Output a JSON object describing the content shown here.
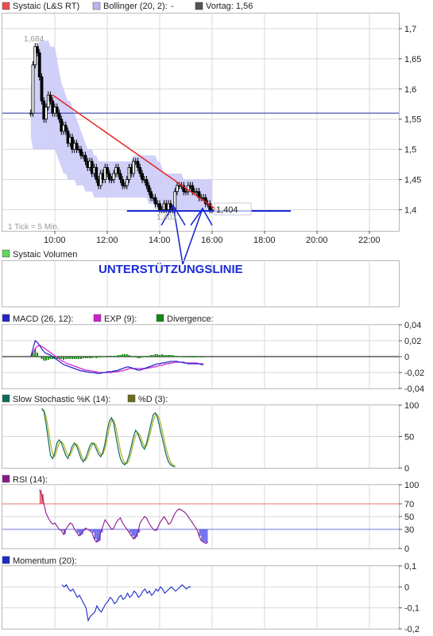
{
  "colors": {
    "price": "#000000",
    "bollinger_fill": "#c8c8f8",
    "vortag": "#1d2a9e",
    "trendline": "#e8231c",
    "support": "#1a2bd6",
    "macd": "#2424c8",
    "exp": "#cc22cc",
    "divergence": "#118811",
    "stoch_k": "#0b6b5a",
    "stoch_d": "#b0b020",
    "rsi": "#8a1a8a",
    "rsi_fill": "#5050e8",
    "rsi_over": "#e85050",
    "momentum": "#1d2ac8"
  },
  "chart_data": [
    {
      "type": "line",
      "legend": [
        {
          "label": "Systaic (L&S RT)",
          "icon": "legend-square-red"
        },
        {
          "label": "Bollinger (20, 2):",
          "value": "-",
          "icon": "legend-square-lavender"
        },
        {
          "label": "Vortag: 1,56",
          "icon": "legend-square-gray"
        }
      ],
      "x_ticks": [
        "10:00",
        "12:00",
        "14:00",
        "16:00",
        "18:00",
        "20:00",
        "22:00"
      ],
      "y_ticks": [
        "1,7",
        "1,65",
        "1,6",
        "1,55",
        "1,5",
        "1,45",
        "1,4"
      ],
      "ylim": [
        1.365,
        1.725
      ],
      "note": "1 Tick = 5 Min.",
      "max_label": "1,684",
      "min_label": "1,403",
      "last_label": "1,404",
      "annotation": "UNTERSTÜTZUNGSLINIE",
      "vortag": 1.56,
      "times": [
        "09:05",
        "09:10",
        "09:15",
        "09:20",
        "09:25",
        "09:30",
        "09:35",
        "09:40",
        "09:45",
        "09:50",
        "09:55",
        "10:00",
        "10:05",
        "10:10",
        "10:15",
        "10:20",
        "10:25",
        "10:30",
        "10:35",
        "10:40",
        "10:45",
        "10:50",
        "10:55",
        "11:00",
        "11:05",
        "11:10",
        "11:15",
        "11:20",
        "11:25",
        "11:30",
        "11:35",
        "11:40",
        "11:45",
        "11:50",
        "11:55",
        "12:00",
        "12:05",
        "12:10",
        "12:15",
        "12:20",
        "12:25",
        "12:30",
        "12:35",
        "12:40",
        "12:45",
        "12:50",
        "12:55",
        "13:00",
        "13:05",
        "13:10",
        "13:15",
        "13:20",
        "13:25",
        "13:30",
        "13:35",
        "13:40",
        "13:45",
        "13:50",
        "13:55",
        "14:00",
        "14:05",
        "14:10",
        "14:15",
        "14:20",
        "14:25",
        "14:30",
        "14:35",
        "14:40",
        "14:45",
        "14:50",
        "14:55",
        "15:00",
        "15:05",
        "15:10",
        "15:15",
        "15:20",
        "15:25",
        "15:30",
        "15:35",
        "15:40",
        "15:45",
        "15:50",
        "15:55",
        "16:00"
      ],
      "close": [
        1.56,
        1.64,
        1.67,
        1.66,
        1.62,
        1.58,
        1.55,
        1.57,
        1.59,
        1.58,
        1.56,
        1.57,
        1.56,
        1.55,
        1.53,
        1.54,
        1.53,
        1.51,
        1.52,
        1.5,
        1.51,
        1.5,
        1.5,
        1.49,
        1.49,
        1.48,
        1.47,
        1.48,
        1.46,
        1.47,
        1.45,
        1.44,
        1.46,
        1.45,
        1.47,
        1.46,
        1.45,
        1.45,
        1.46,
        1.47,
        1.46,
        1.45,
        1.44,
        1.44,
        1.45,
        1.47,
        1.46,
        1.48,
        1.48,
        1.47,
        1.46,
        1.45,
        1.45,
        1.44,
        1.43,
        1.42,
        1.42,
        1.41,
        1.41,
        1.4,
        1.4,
        1.41,
        1.4,
        1.41,
        1.4,
        1.4,
        1.43,
        1.44,
        1.44,
        1.44,
        1.43,
        1.43,
        1.44,
        1.44,
        1.43,
        1.43,
        1.43,
        1.42,
        1.42,
        1.42,
        1.41,
        1.41,
        1.4,
        1.4
      ],
      "bollinger_upper": [
        1.6,
        1.64,
        1.66,
        1.67,
        1.68,
        1.68,
        1.68,
        1.68,
        1.68,
        1.67,
        1.67,
        1.67,
        1.65,
        1.63,
        1.61,
        1.6,
        1.59,
        1.58,
        1.58,
        1.57,
        1.56,
        1.55,
        1.54,
        1.53,
        1.52,
        1.51,
        1.5,
        1.5,
        1.5,
        1.49,
        1.49,
        1.48,
        1.48,
        1.48,
        1.48,
        1.48,
        1.48,
        1.48,
        1.48,
        1.48,
        1.48,
        1.48,
        1.48,
        1.48,
        1.48,
        1.48,
        1.48,
        1.49,
        1.49,
        1.49,
        1.49,
        1.49,
        1.49,
        1.49,
        1.49,
        1.49,
        1.49,
        1.49,
        1.48,
        1.48,
        1.47,
        1.46,
        1.46,
        1.46,
        1.46,
        1.46,
        1.46,
        1.46,
        1.46,
        1.46,
        1.45,
        1.45,
        1.45,
        1.45,
        1.45,
        1.45,
        1.45,
        1.45,
        1.45,
        1.45,
        1.45,
        1.45,
        1.45,
        1.45
      ],
      "bollinger_lower": [
        1.52,
        1.5,
        1.5,
        1.5,
        1.5,
        1.5,
        1.5,
        1.5,
        1.5,
        1.5,
        1.5,
        1.5,
        1.49,
        1.48,
        1.47,
        1.46,
        1.46,
        1.45,
        1.45,
        1.45,
        1.45,
        1.44,
        1.44,
        1.44,
        1.44,
        1.43,
        1.43,
        1.43,
        1.43,
        1.42,
        1.42,
        1.42,
        1.42,
        1.42,
        1.42,
        1.42,
        1.42,
        1.42,
        1.42,
        1.42,
        1.42,
        1.42,
        1.42,
        1.42,
        1.42,
        1.42,
        1.42,
        1.42,
        1.42,
        1.42,
        1.42,
        1.42,
        1.42,
        1.42,
        1.41,
        1.41,
        1.41,
        1.4,
        1.4,
        1.4,
        1.4,
        1.4,
        1.4,
        1.4,
        1.4,
        1.4,
        1.4,
        1.4,
        1.4,
        1.4,
        1.4,
        1.4,
        1.4,
        1.4,
        1.4,
        1.4,
        1.4,
        1.4,
        1.4,
        1.4,
        1.4,
        1.4,
        1.4,
        1.4
      ]
    },
    {
      "type": "bar",
      "legend": [
        {
          "label": "Systaic Volumen",
          "icon": "legend-square-green"
        }
      ],
      "values": []
    },
    {
      "type": "line",
      "legend": [
        {
          "label": "MACD (26, 12):",
          "icon": "legend-square-blue"
        },
        {
          "label": "EXP (9):",
          "icon": "legend-square-magenta"
        },
        {
          "label": "Divergence:",
          "icon": "legend-square-darkgreen"
        }
      ],
      "y_ticks": [
        "0,04",
        "0,02",
        "0",
        "-0,02",
        "-0,04"
      ],
      "ylim": [
        -0.04,
        0.04
      ],
      "macd": [
        0.0,
        0.01,
        0.02,
        0.018,
        0.014,
        0.01,
        0.006,
        0.004,
        0.003,
        0.002,
        0.0,
        -0.002,
        -0.004,
        -0.006,
        -0.008,
        -0.01,
        -0.011,
        -0.012,
        -0.013,
        -0.014,
        -0.015,
        -0.016,
        -0.017,
        -0.018,
        -0.018,
        -0.019,
        -0.019,
        -0.02,
        -0.02,
        -0.02,
        -0.021,
        -0.021,
        -0.021,
        -0.02,
        -0.02,
        -0.019,
        -0.019,
        -0.019,
        -0.018,
        -0.018,
        -0.017,
        -0.016,
        -0.015,
        -0.014,
        -0.013,
        -0.013,
        -0.014,
        -0.015,
        -0.016,
        -0.017,
        -0.017,
        -0.016,
        -0.015,
        -0.014,
        -0.013,
        -0.012,
        -0.011,
        -0.01,
        -0.009,
        -0.009,
        -0.008,
        -0.008,
        -0.007,
        -0.007,
        -0.006,
        -0.006,
        -0.006,
        -0.006,
        -0.007,
        -0.007,
        -0.008,
        -0.008,
        -0.009,
        -0.009,
        -0.009,
        -0.009,
        -0.009,
        -0.009,
        -0.01,
        -0.01
      ],
      "exp": [
        0.0,
        0.005,
        0.01,
        0.013,
        0.014,
        0.013,
        0.011,
        0.009,
        0.007,
        0.005,
        0.003,
        0.001,
        -0.001,
        -0.003,
        -0.005,
        -0.006,
        -0.008,
        -0.009,
        -0.01,
        -0.011,
        -0.012,
        -0.013,
        -0.014,
        -0.015,
        -0.016,
        -0.017,
        -0.017,
        -0.018,
        -0.018,
        -0.019,
        -0.019,
        -0.02,
        -0.02,
        -0.02,
        -0.02,
        -0.02,
        -0.02,
        -0.02,
        -0.019,
        -0.019,
        -0.019,
        -0.018,
        -0.018,
        -0.017,
        -0.016,
        -0.015,
        -0.015,
        -0.015,
        -0.015,
        -0.015,
        -0.015,
        -0.015,
        -0.015,
        -0.015,
        -0.014,
        -0.014,
        -0.013,
        -0.013,
        -0.012,
        -0.011,
        -0.011,
        -0.01,
        -0.009,
        -0.009,
        -0.008,
        -0.008,
        -0.007,
        -0.007,
        -0.007,
        -0.007,
        -0.007,
        -0.008,
        -0.008,
        -0.008,
        -0.008,
        -0.008,
        -0.008,
        -0.009,
        -0.009,
        -0.009
      ],
      "divergence": [
        0.0,
        0.005,
        0.01,
        0.005,
        0.0,
        -0.003,
        -0.005,
        -0.005,
        -0.004,
        -0.003,
        -0.003,
        -0.003,
        -0.003,
        -0.003,
        -0.003,
        -0.004,
        -0.003,
        -0.003,
        -0.003,
        -0.003,
        -0.003,
        -0.003,
        -0.003,
        -0.003,
        -0.002,
        -0.002,
        -0.002,
        -0.002,
        -0.002,
        -0.001,
        -0.002,
        -0.001,
        -0.001,
        0.0,
        0.0,
        0.001,
        0.001,
        0.001,
        0.001,
        0.001,
        0.002,
        0.002,
        0.003,
        0.003,
        0.003,
        0.002,
        0.001,
        0.0,
        -0.001,
        -0.002,
        -0.002,
        -0.001,
        0.0,
        0.001,
        0.001,
        0.002,
        0.002,
        0.003,
        0.003,
        0.002,
        0.003,
        0.002,
        0.002,
        0.002,
        0.002,
        0.002,
        0.001,
        0.001,
        0.0,
        0.0,
        -0.001,
        0.0,
        -0.001,
        -0.001,
        -0.001,
        -0.001,
        -0.001,
        0.0,
        -0.001,
        -0.001
      ]
    },
    {
      "type": "line",
      "legend": [
        {
          "label": "Slow Stochastic %K (14):",
          "icon": "legend-square-teal"
        },
        {
          "label": "%D (3):",
          "icon": "legend-square-olive"
        }
      ],
      "y_ticks": [
        "100",
        "50",
        "0"
      ],
      "ylim": [
        0,
        100
      ],
      "k": [
        95,
        90,
        70,
        45,
        20,
        15,
        25,
        40,
        45,
        40,
        30,
        20,
        15,
        25,
        35,
        40,
        35,
        25,
        15,
        10,
        15,
        25,
        35,
        40,
        38,
        30,
        22,
        18,
        25,
        40,
        60,
        75,
        80,
        70,
        50,
        30,
        15,
        8,
        5,
        10,
        20,
        35,
        50,
        60,
        55,
        45,
        35,
        30,
        40,
        55,
        70,
        85,
        88,
        80,
        65,
        50,
        35,
        20,
        10,
        5,
        3,
        2
      ],
      "d": [
        92,
        92,
        82,
        62,
        40,
        22,
        18,
        30,
        40,
        42,
        38,
        28,
        20,
        20,
        28,
        36,
        38,
        32,
        22,
        14,
        12,
        18,
        28,
        36,
        40,
        36,
        28,
        22,
        22,
        32,
        48,
        65,
        76,
        76,
        64,
        46,
        28,
        15,
        8,
        7,
        12,
        25,
        40,
        52,
        56,
        52,
        42,
        34,
        35,
        46,
        60,
        75,
        84,
        85,
        76,
        62,
        46,
        30,
        18,
        9,
        5,
        3
      ]
    },
    {
      "type": "line",
      "legend": [
        {
          "label": "RSI (14):",
          "icon": "legend-square-purple"
        }
      ],
      "y_ticks": [
        "100",
        "70",
        "50",
        "30",
        "0"
      ],
      "ylim": [
        0,
        100
      ],
      "levels": [
        70,
        30
      ],
      "rsi": [
        92,
        85,
        70,
        55,
        48,
        42,
        38,
        40,
        35,
        30,
        28,
        22,
        30,
        35,
        40,
        38,
        30,
        25,
        20,
        22,
        28,
        32,
        30,
        28,
        25,
        15,
        10,
        12,
        25,
        35,
        45,
        40,
        35,
        30,
        32,
        40,
        45,
        48,
        40,
        35,
        30,
        25,
        20,
        15,
        18,
        25,
        40,
        45,
        50,
        48,
        40,
        35,
        30,
        28,
        32,
        40,
        45,
        50,
        45,
        38,
        40,
        48,
        55,
        60,
        62,
        60,
        58,
        55,
        50,
        45,
        40,
        35,
        30,
        20,
        12,
        10,
        8,
        10
      ]
    },
    {
      "type": "line",
      "legend": [
        {
          "label": "Momentum (20):",
          "icon": "legend-square-navy"
        }
      ],
      "y_ticks": [
        "0,1",
        "0",
        "-0,1",
        "-0,2"
      ],
      "ylim": [
        -0.2,
        0.1
      ],
      "momentum": [
        0.01,
        0.0,
        0.01,
        -0.01,
        -0.02,
        -0.01,
        -0.03,
        -0.05,
        -0.04,
        -0.06,
        -0.08,
        -0.1,
        -0.16,
        -0.14,
        -0.13,
        -0.12,
        -0.09,
        -0.11,
        -0.12,
        -0.1,
        -0.08,
        -0.07,
        -0.05,
        -0.06,
        -0.08,
        -0.07,
        -0.05,
        -0.04,
        -0.06,
        -0.05,
        -0.03,
        -0.05,
        -0.04,
        -0.02,
        -0.03,
        -0.05,
        -0.04,
        -0.02,
        -0.01,
        -0.03,
        -0.02,
        -0.04,
        -0.03,
        -0.01,
        -0.02,
        0.0,
        -0.01,
        -0.03,
        -0.02,
        -0.01,
        0.0,
        -0.01,
        -0.02,
        -0.01,
        0.0,
        0.01,
        0.0,
        -0.01,
        0.0,
        0.0
      ]
    }
  ]
}
